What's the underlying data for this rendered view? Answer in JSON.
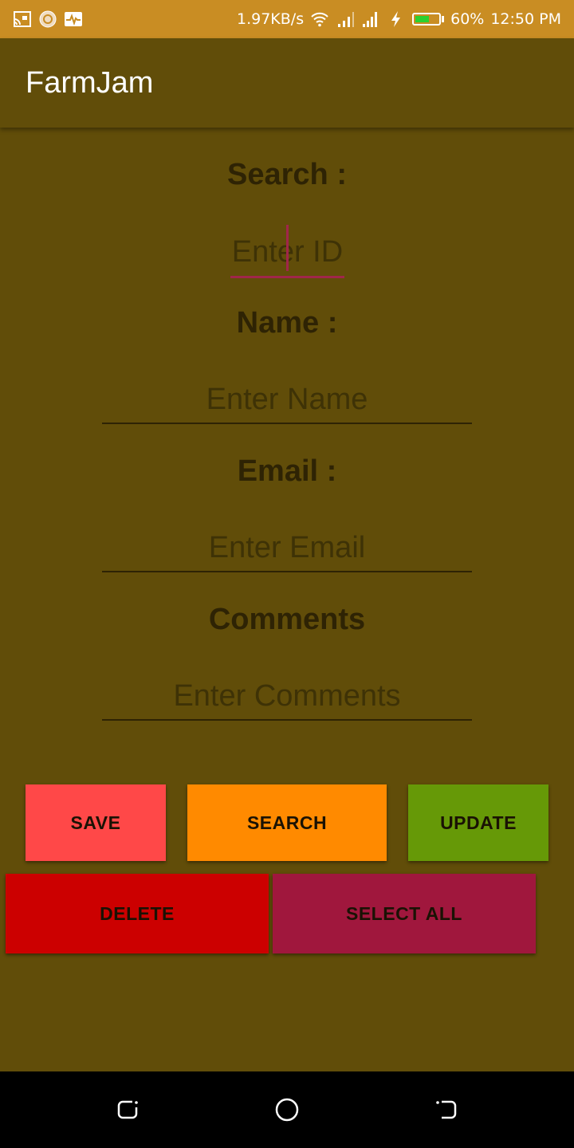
{
  "status_bar": {
    "net_speed": "1.97KB/s",
    "battery_pct": "60%",
    "battery_level": 0.6,
    "time": "12:50 PM",
    "left_icons": [
      "cast-icon",
      "app-icon",
      "activity-icon"
    ],
    "right_icons": [
      "wifi-icon",
      "signal-icon",
      "signal-icon",
      "charging-icon",
      "battery-icon"
    ]
  },
  "app_bar": {
    "title": "FarmJam"
  },
  "form": {
    "search_label": "Search :",
    "id_placeholder": "Enter ID",
    "name_label": "Name :",
    "name_placeholder": "Enter Name",
    "email_label": "Email :",
    "email_placeholder": "Enter Email",
    "comments_label": "Comments",
    "comments_placeholder": "Enter Comments"
  },
  "buttons": {
    "save": "SAVE",
    "search": "SEARCH",
    "update": "UPDATE",
    "delete": "DELETE",
    "select_all": "SELECT ALL"
  },
  "colors": {
    "status_bar": "#c98d23",
    "background": "#614d09",
    "save": "#ff4848",
    "search": "#ff8a00",
    "update": "#669907",
    "delete": "#cc0000",
    "select_all": "#a0173d",
    "focus_accent": "#a0264a"
  },
  "nav_bar": {
    "icons": [
      "recents-icon",
      "home-icon",
      "back-icon"
    ]
  }
}
